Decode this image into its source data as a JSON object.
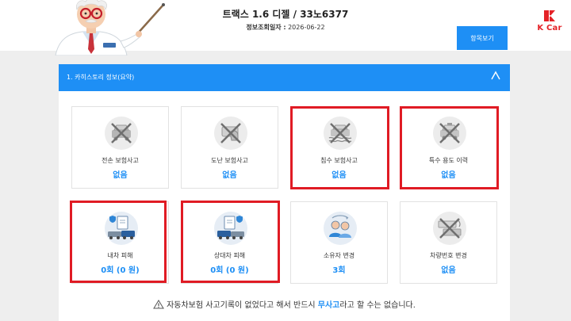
{
  "header": {
    "title": "트랙스 1.6 디젤 / 33노6377",
    "date_label": "정보조회일자 :",
    "date_value": "2026-06-22",
    "items_button": "항목보기",
    "logo_text": "K Car"
  },
  "section": {
    "title": "1. 카히스토리 정보(요약)",
    "collapse_icon": "chevron-up-icon"
  },
  "tiles": [
    {
      "label": "전손 보험사고",
      "value": "없음",
      "icon": "total-loss-car-icon",
      "highlighted": false
    },
    {
      "label": "도난 보험사고",
      "value": "없음",
      "icon": "theft-icon",
      "highlighted": false
    },
    {
      "label": "침수 보험사고",
      "value": "없음",
      "icon": "flood-car-icon",
      "highlighted": true
    },
    {
      "label": "특수 용도 이력",
      "value": "없음",
      "icon": "special-use-car-icon",
      "highlighted": true
    },
    {
      "label": "내차 피해",
      "value": "0회 (0 원)",
      "icon": "my-car-damage-icon",
      "highlighted": true
    },
    {
      "label": "상대차 피해",
      "value": "0회 (0 원)",
      "icon": "other-car-damage-icon",
      "highlighted": true
    },
    {
      "label": "소유자 변경",
      "value": "3회",
      "icon": "owner-change-icon",
      "highlighted": false
    },
    {
      "label": "차량번호 변경",
      "value": "없음",
      "icon": "plate-change-icon",
      "highlighted": false
    }
  ],
  "notice": {
    "before": "자동차보험 사고기록이 없었다고 해서 반드시 ",
    "emphasis": "무사고",
    "after": "라고 할 수는 없습니다."
  },
  "colors": {
    "accent": "#1e8ff5",
    "highlight_border": "#e01b24",
    "brand_red": "#e42227"
  }
}
